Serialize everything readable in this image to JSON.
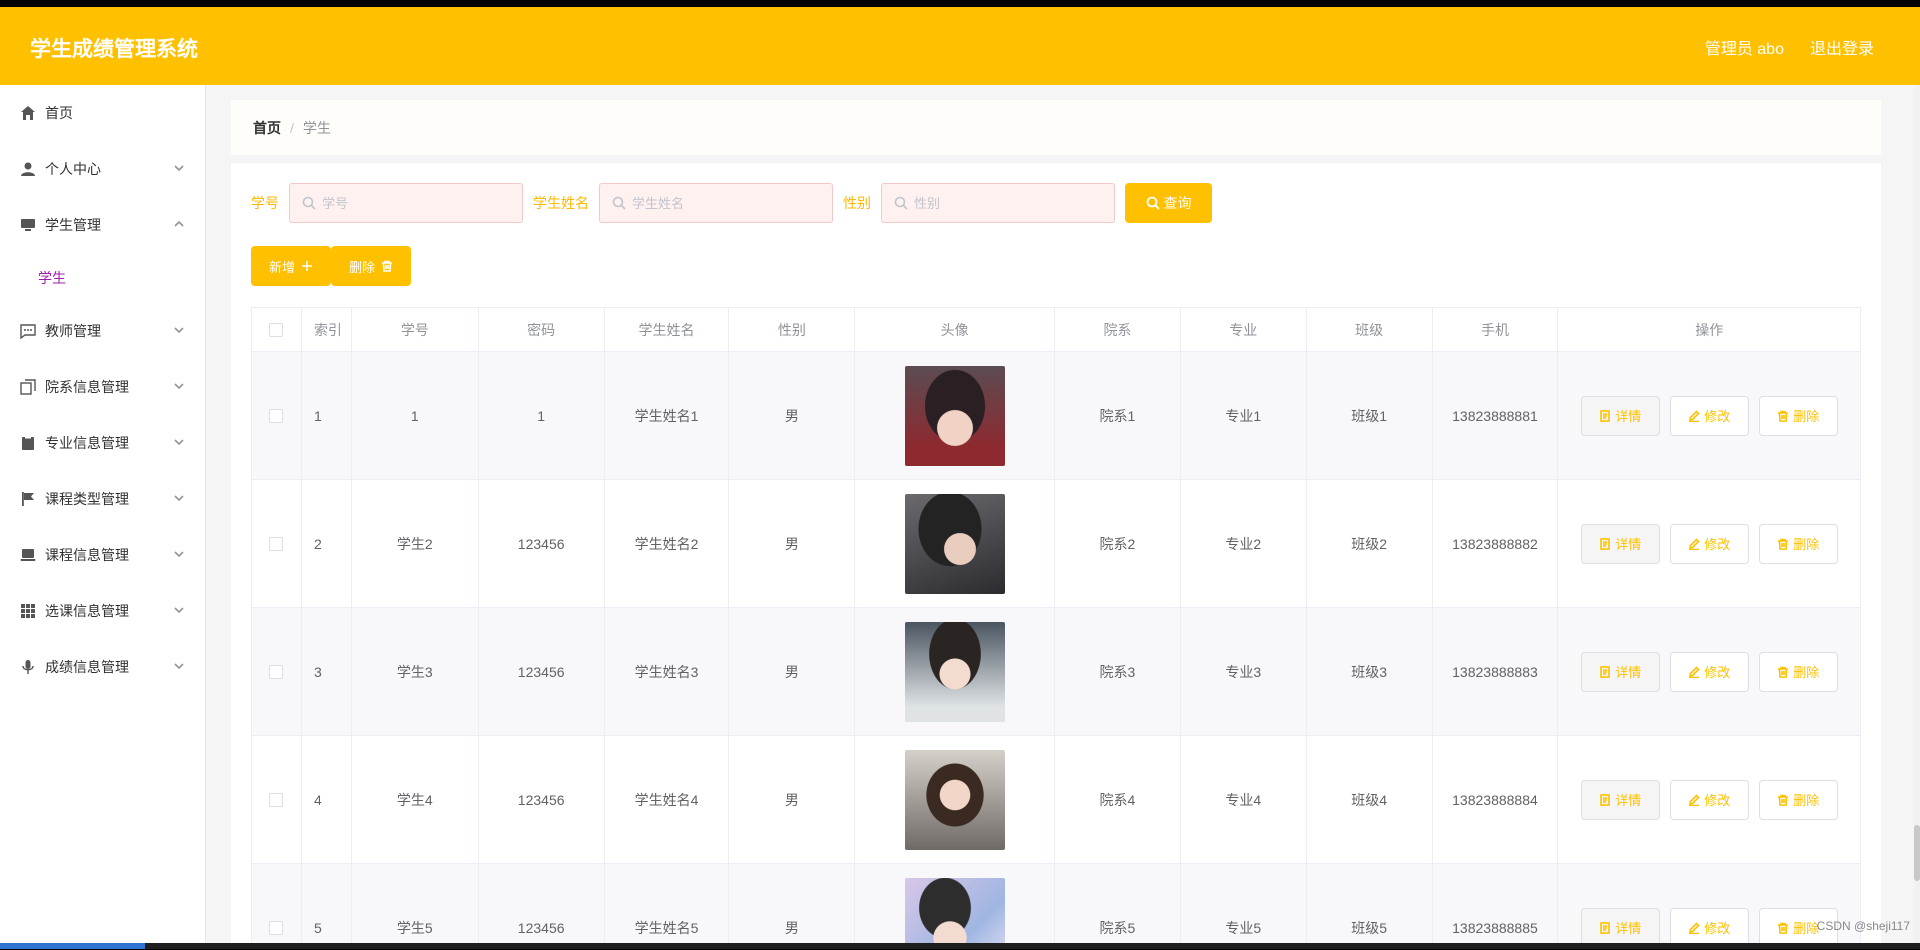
{
  "header": {
    "title": "学生成绩管理系统",
    "user": "管理员 abo",
    "logout": "退出登录"
  },
  "sidebar": {
    "items": [
      {
        "label": "首页"
      },
      {
        "label": "个人中心"
      },
      {
        "label": "学生管理"
      },
      {
        "label": "教师管理"
      },
      {
        "label": "院系信息管理"
      },
      {
        "label": "专业信息管理"
      },
      {
        "label": "课程类型管理"
      },
      {
        "label": "课程信息管理"
      },
      {
        "label": "选课信息管理"
      },
      {
        "label": "成绩信息管理"
      }
    ],
    "sub_item": "学生"
  },
  "breadcrumb": {
    "home": "首页",
    "current": "学生"
  },
  "search": {
    "id_label": "学号",
    "id_placeholder": "学号",
    "name_label": "学生姓名",
    "name_placeholder": "学生姓名",
    "gender_label": "性别",
    "gender_placeholder": "性别",
    "query_button": "查询"
  },
  "actions": {
    "add": "新增",
    "delete": "删除"
  },
  "table": {
    "headers": [
      "索引",
      "学号",
      "密码",
      "学生姓名",
      "性别",
      "头像",
      "院系",
      "专业",
      "班级",
      "手机",
      "操作"
    ],
    "rows": [
      {
        "index": "1",
        "id": "1",
        "password": "1",
        "name": "学生姓名1",
        "gender": "男",
        "dept": "院系1",
        "major": "专业1",
        "class": "班级1",
        "phone": "13823888881"
      },
      {
        "index": "2",
        "id": "学生2",
        "password": "123456",
        "name": "学生姓名2",
        "gender": "男",
        "dept": "院系2",
        "major": "专业2",
        "class": "班级2",
        "phone": "13823888882"
      },
      {
        "index": "3",
        "id": "学生3",
        "password": "123456",
        "name": "学生姓名3",
        "gender": "男",
        "dept": "院系3",
        "major": "专业3",
        "class": "班级3",
        "phone": "13823888883"
      },
      {
        "index": "4",
        "id": "学生4",
        "password": "123456",
        "name": "学生姓名4",
        "gender": "男",
        "dept": "院系4",
        "major": "专业4",
        "class": "班级4",
        "phone": "13823888884"
      },
      {
        "index": "5",
        "id": "学生5",
        "password": "123456",
        "name": "学生姓名5",
        "gender": "男",
        "dept": "院系5",
        "major": "专业5",
        "class": "班级5",
        "phone": "13823888885"
      }
    ],
    "op_detail": "详情",
    "op_edit": "修改",
    "op_delete": "删除"
  },
  "watermark": "CSDN @sheji117",
  "colors": {
    "primary": "#ffc000",
    "active_sub": "#9b1ea8"
  }
}
